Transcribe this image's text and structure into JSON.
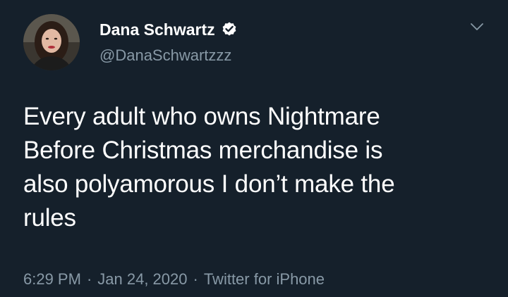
{
  "user": {
    "display_name": "Dana Schwartz",
    "handle": "@DanaSchwartzzz",
    "verified": true,
    "avatar_icon": "profile-photo"
  },
  "tweet": {
    "lines": [
      "Every adult who owns Nightmare",
      "Before Christmas merchandise is",
      "also polyamorous I don’t make the",
      "rules"
    ]
  },
  "meta": {
    "time": "6:29 PM",
    "separator": "·",
    "date": "Jan 24, 2020",
    "source": "Twitter for iPhone"
  },
  "colors": {
    "background": "#15202b",
    "primary_text": "#ffffff",
    "secondary_text": "#8899a6",
    "verified_badge": "#ffffff"
  },
  "icons": {
    "verified": "verified-badge-icon",
    "menu": "chevron-down-icon"
  }
}
